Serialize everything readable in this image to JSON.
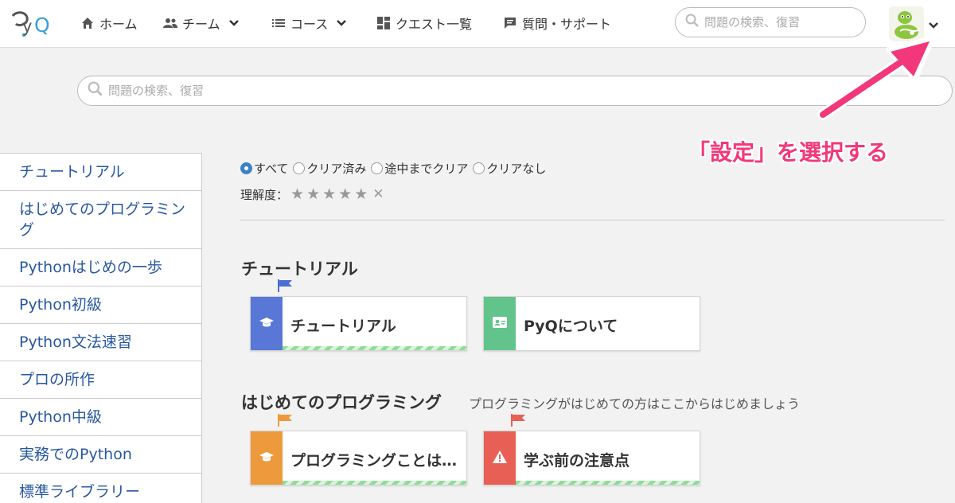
{
  "header": {
    "logo_text": "PyQ",
    "nav": [
      {
        "label": "ホーム",
        "icon": "home-icon",
        "dropdown": false
      },
      {
        "label": "チーム",
        "icon": "team-icon",
        "dropdown": true
      },
      {
        "label": "コース",
        "icon": "list-icon",
        "dropdown": true
      },
      {
        "label": "クエスト一覧",
        "icon": "grid-icon",
        "dropdown": false
      },
      {
        "label": "質問・サポート",
        "icon": "chat-icon",
        "dropdown": false
      }
    ],
    "search_placeholder": "問題の検索、復習"
  },
  "main_search_placeholder": "問題の検索、復習",
  "annotation": "「設定」を選択する",
  "sidebar": {
    "items": [
      {
        "label": "チュートリアル"
      },
      {
        "label": "はじめてのプログラミング"
      },
      {
        "label": "Pythonはじめの一歩"
      },
      {
        "label": "Python初級"
      },
      {
        "label": "Python文法速習"
      },
      {
        "label": "プロの所作"
      },
      {
        "label": "Python中級"
      },
      {
        "label": "実務でのPython"
      },
      {
        "label": "標準ライブラリー"
      }
    ]
  },
  "filters": {
    "options": [
      "すべて",
      "クリア済み",
      "途中までクリア",
      "クリアなし"
    ],
    "selected": "すべて",
    "rating_label": "理解度：",
    "stars": 5
  },
  "sections": [
    {
      "title": "チュートリアル",
      "subtitle": "",
      "cards": [
        {
          "title": "チュートリアル",
          "color": "#5877d6",
          "icon": "graduation-cap-icon",
          "flag_color": "#4b6fd4",
          "progress": 1.0
        },
        {
          "title": "PyQについて",
          "color": "#62c48a",
          "icon": "id-card-icon",
          "flag_color": null,
          "progress": 0
        }
      ]
    },
    {
      "title": "はじめてのプログラミング",
      "subtitle": "プログラミングがはじめての方はここからはじめましょう",
      "cards": [
        {
          "title": "プログラミングことはじめ",
          "color": "#ec9a3c",
          "icon": "graduation-cap-icon",
          "flag_color": "#ec9a3c",
          "progress": 1.0
        },
        {
          "title": "学ぶ前の注意点",
          "color": "#e85f55",
          "icon": "warning-icon",
          "flag_color": "#e85f55",
          "progress": 1.0
        }
      ]
    }
  ],
  "colors": {
    "link": "#2757a0",
    "annotation": "#f2387a",
    "radio_selected": "#3b82c4"
  }
}
